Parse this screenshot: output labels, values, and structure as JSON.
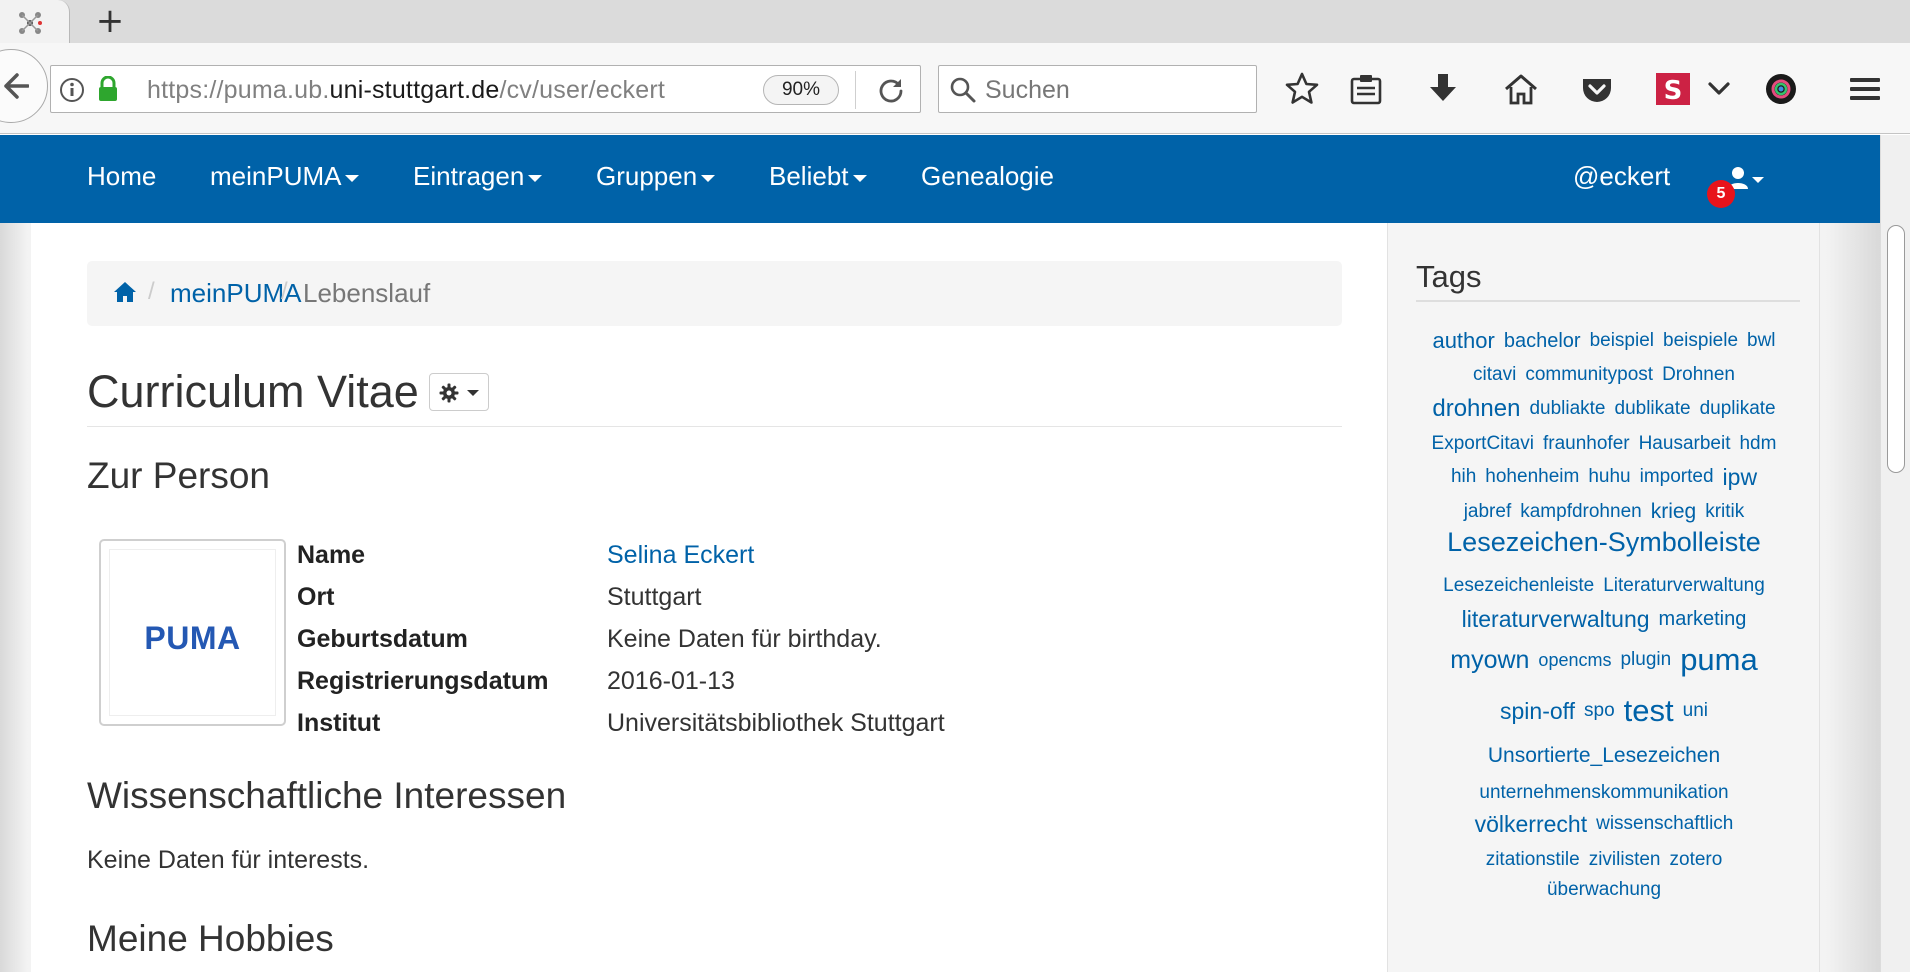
{
  "browser": {
    "new_tab_symbol": "+",
    "url_prefix": "https://puma.ub.",
    "url_domain": "uni-stuttgart.de",
    "url_path": "/cv/user/eckert",
    "zoom": "90%",
    "search_placeholder": "Suchen"
  },
  "site_nav": {
    "items": [
      {
        "label": "Home"
      },
      {
        "label": "meinPUMA"
      },
      {
        "label": "Eintragen"
      },
      {
        "label": "Gruppen"
      },
      {
        "label": "Beliebt"
      },
      {
        "label": "Genealogie"
      }
    ],
    "user": "@eckert",
    "notification_count": "5"
  },
  "breadcrumb": {
    "sep": "/",
    "items": [
      "meinPUMA"
    ],
    "active": "Lebenslauf"
  },
  "page": {
    "title": "Curriculum Vitae",
    "section_person": "Zur Person",
    "avatar_logo": "PUMA",
    "person": [
      {
        "label": "Name",
        "value": "Selina Eckert"
      },
      {
        "label": "Ort",
        "value": "Stuttgart"
      },
      {
        "label": "Geburtsdatum",
        "value": "Keine Daten für birthday."
      },
      {
        "label": "Registrierungsdatum",
        "value": "2016-01-13"
      },
      {
        "label": "Institut",
        "value": "Universitätsbibliothek Stuttgart"
      }
    ],
    "section_interests": "Wissenschaftliche Interessen",
    "interests_text": "Keine Daten für interests.",
    "section_hobbies": "Meine Hobbies"
  },
  "sidebar": {
    "title": "Tags",
    "tags": [
      "author",
      "bachelor",
      "beispiel",
      "beispiele",
      "bwl",
      "citavi",
      "communitypost",
      "Drohnen",
      "drohnen",
      "dubliakte",
      "dublikate",
      "duplikate",
      "ExportCitavi",
      "fraunhofer",
      "Hausarbeit",
      "hdm",
      "hih",
      "hohenheim",
      "huhu",
      "imported",
      "ipw",
      "jabref",
      "kampfdrohnen",
      "krieg",
      "kritik",
      "Lesezeichen-Symbolleiste",
      "Lesezeichenleiste",
      "Literaturverwaltung",
      "literaturverwaltung",
      "marketing",
      "myown",
      "opencms",
      "plugin",
      "puma",
      "spin-off",
      "spo",
      "test",
      "uni",
      "Unsortierte_Lesezeichen",
      "unternehmenskommunikation",
      "völkerrecht",
      "wissenschaftlich",
      "zitationstile",
      "zivilisten",
      "zotero",
      "überwachung"
    ]
  },
  "colors": {
    "brand_blue": "#0062a8",
    "badge_red": "#e8131b",
    "pocket_red": "#d7334a",
    "stylish_red": "#cc2244"
  }
}
